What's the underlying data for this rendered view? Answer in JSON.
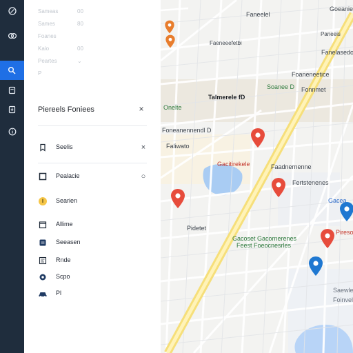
{
  "rail": {
    "items": [
      {
        "name": "menu",
        "active": false
      },
      {
        "name": "layers",
        "active": false
      },
      {
        "name": "search",
        "active": true
      },
      {
        "name": "saved",
        "active": false
      },
      {
        "name": "download",
        "active": false
      },
      {
        "name": "info",
        "active": false
      }
    ]
  },
  "panel": {
    "faded": [
      {
        "left": "Sameas",
        "right": "00"
      },
      {
        "left": "Sames",
        "right": "80"
      },
      {
        "left": "Foanes",
        "right": ""
      },
      {
        "left": "Kaio",
        "right": "00"
      },
      {
        "left": "Peartes",
        "right": "⌄"
      },
      {
        "left": "P",
        "right": ""
      }
    ],
    "title": "Piereels Foniees",
    "close_icon": "close-icon",
    "items": [
      {
        "name": "search",
        "label": "Seelis",
        "icon": "bookmark-icon",
        "trailing": "×"
      },
      {
        "name": "places",
        "label": "Pealacie",
        "icon": "square-icon",
        "trailing": "○"
      },
      {
        "name": "saved",
        "label": "Searien",
        "icon": "pin-icon",
        "trailing": ""
      },
      {
        "name": "alarms",
        "label": "Allime",
        "icon": "calendar-icon",
        "trailing": ""
      },
      {
        "name": "session",
        "label": "Seeasen",
        "icon": "grid-icon",
        "trailing": ""
      },
      {
        "name": "ride",
        "label": "Rnde",
        "icon": "text-icon",
        "trailing": ""
      },
      {
        "name": "share",
        "label": "Scpo",
        "icon": "camera-icon",
        "trailing": ""
      },
      {
        "name": "profile",
        "label": "Pl",
        "icon": "car-icon",
        "trailing": ""
      }
    ]
  },
  "map": {
    "labels": [
      {
        "text": "Faneelel",
        "style": "normal"
      },
      {
        "text": "Goeanie",
        "style": "normal"
      },
      {
        "text": "Fanelasedoke",
        "style": "normal"
      },
      {
        "text": "Foaneneetice",
        "style": "normal"
      },
      {
        "text": "Talmerele fD",
        "style": "bold-dark"
      },
      {
        "text": "Soanee D",
        "style": "green"
      },
      {
        "text": "Onelte",
        "style": "green"
      },
      {
        "text": "Foneanennendl D",
        "style": "normal"
      },
      {
        "text": "Faliwato",
        "style": "normal"
      },
      {
        "text": "Gacitirekele",
        "style": "red"
      },
      {
        "text": "Faadnernenne",
        "style": "normal"
      },
      {
        "text": "Gacea",
        "style": "blue"
      },
      {
        "text": "Pireso",
        "style": "red"
      },
      {
        "text": "Pidetet",
        "style": "normal"
      },
      {
        "text": "Gacoset Gacornerenes",
        "style": "green"
      },
      {
        "text": "Feest Foeocnesrles",
        "style": "green"
      },
      {
        "text": "Saewle",
        "style": "muted"
      },
      {
        "text": "Foinvele",
        "style": "muted"
      },
      {
        "text": "Fonnmet",
        "style": "normal"
      },
      {
        "text": "Fertstenenes",
        "style": "normal"
      },
      {
        "text": "Faeneeefetbi",
        "style": "normal"
      },
      {
        "text": "Paneeis",
        "style": "normal"
      }
    ],
    "pins": [
      {
        "color": "#e74c3c"
      },
      {
        "color": "#e74c3c"
      },
      {
        "color": "#e74c3c"
      },
      {
        "color": "#e74c3c"
      },
      {
        "color": "#1f78d1"
      },
      {
        "color": "#1f78d1"
      },
      {
        "color": "#e74c3c"
      },
      {
        "color": "#e74c3c"
      }
    ]
  }
}
